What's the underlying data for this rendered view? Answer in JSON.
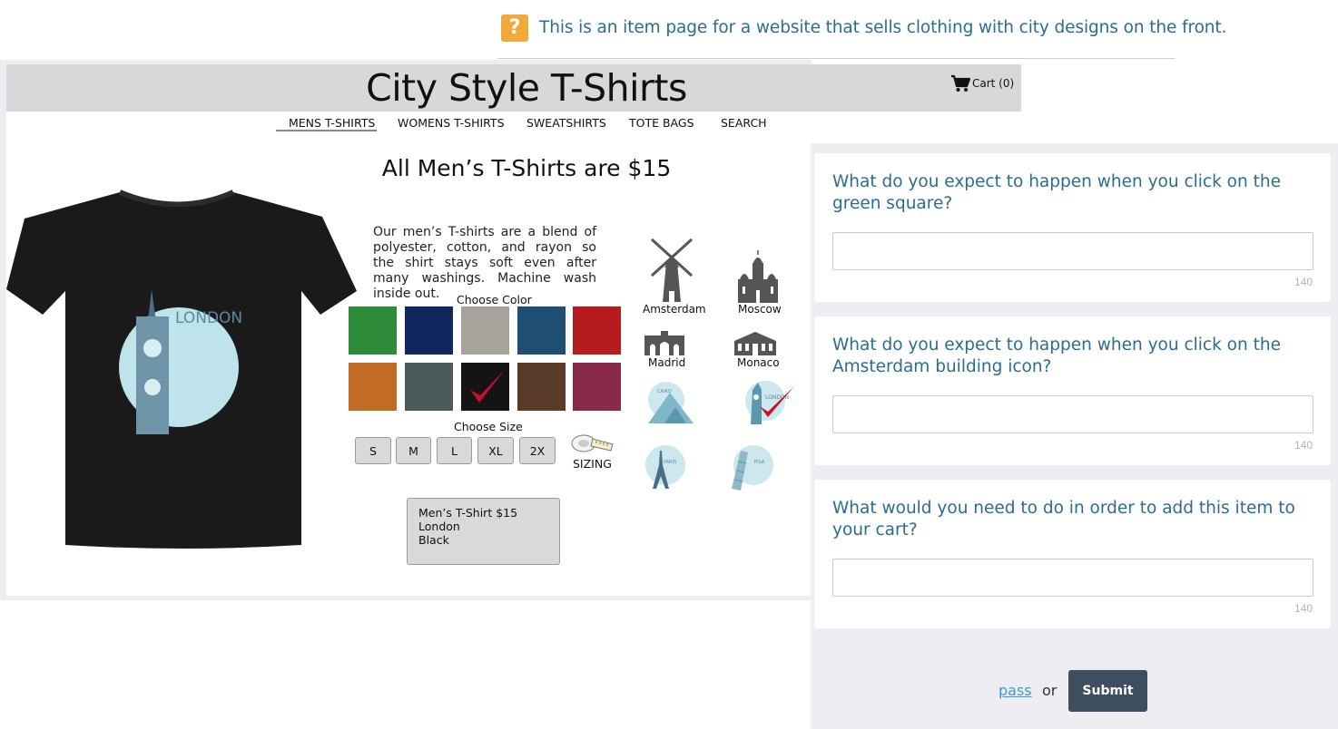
{
  "task": {
    "text": "This is an item page for a website that sells clothing with city designs on the front.",
    "icon": "question-icon",
    "icon_color": "#f2a93b"
  },
  "site": {
    "title": "City Style T-Shirts",
    "cart_label": "Cart (0)",
    "nav": [
      "MENS T-SHIRTS",
      "WOMENS T-SHIRTS",
      "SWEATSHIRTS",
      "TOTE BAGS",
      "SEARCH"
    ],
    "active_nav": "MENS T-SHIRTS",
    "headline": "All Men’s T-Shirts are $15",
    "description": "Our men’s T-shirts are a blend of polyester, cotton, and rayon so the shirt stays soft even after many washings. Machine wash inside out.",
    "shirt_print_text": "LONDON",
    "choose_color_label": "Choose Color",
    "colors": [
      "#2e8b3a",
      "#12275e",
      "#a5a39b",
      "#1e4f73",
      "#b41c1f",
      "#c26b25",
      "#4c5a5a",
      "#141414",
      "#5a3a28",
      "#8a2a4a"
    ],
    "selected_color_index": 7,
    "choose_size_label": "Choose Size",
    "sizes": [
      "S",
      "M",
      "L",
      "XL",
      "2X"
    ],
    "sizing_label": "SIZING",
    "cities": [
      "Amsterdam",
      "Moscow",
      "Madrid",
      "Monaco"
    ],
    "badge_texts": [
      "CAIRO",
      "LONDON",
      "PARIS",
      "PISA"
    ],
    "selected_city_design": "London",
    "summary": [
      "Men’s T-Shirt $15",
      "London",
      "Black"
    ],
    "check_color": "#c8102e"
  },
  "questions": [
    {
      "text": "What do you expect to happen when you click on the green square?",
      "value": "",
      "limit": "140"
    },
    {
      "text": "What do you expect to happen when you click on the Amsterdam building icon?",
      "value": "",
      "limit": "140"
    },
    {
      "text": "What would you need to do in order to add this item to your cart?",
      "value": "",
      "limit": "140"
    }
  ],
  "actions": {
    "pass_label": "pass",
    "or_label": "or",
    "submit_label": "Submit"
  },
  "colors": {
    "question_text": "#2b6d8e",
    "submit_bg": "#3d4e5e",
    "link": "#3d9ad6"
  }
}
